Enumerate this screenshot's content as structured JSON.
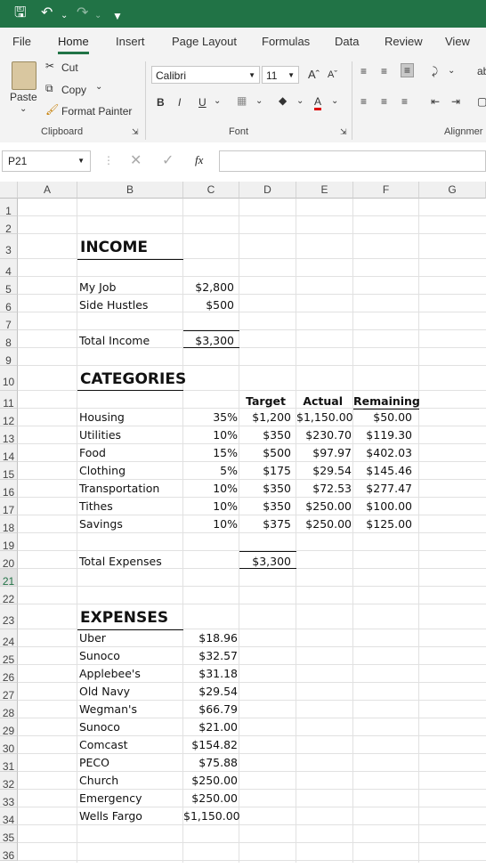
{
  "qat": {
    "save_icon": "save-icon",
    "undo_icon": "undo-icon",
    "redo_icon": "redo-icon",
    "customize_icon": "customize-icon"
  },
  "tabs": [
    "File",
    "Home",
    "Insert",
    "Page Layout",
    "Formulas",
    "Data",
    "Review",
    "View"
  ],
  "ribbon": {
    "clipboard": {
      "paste": "Paste",
      "cut": "Cut",
      "copy": "Copy",
      "format_painter": "Format Painter",
      "label": "Clipboard"
    },
    "font": {
      "name": "Calibri",
      "size": "11",
      "bold": "B",
      "italic": "I",
      "underline": "U",
      "label": "Font"
    },
    "alignment": {
      "label": "Alignmer"
    }
  },
  "formula_bar": {
    "namebox": "P21",
    "fx": "fx",
    "value": ""
  },
  "columns": [
    "A",
    "B",
    "C",
    "D",
    "E",
    "F",
    "G"
  ],
  "rows": [
    "1",
    "2",
    "3",
    "4",
    "5",
    "6",
    "7",
    "8",
    "9",
    "10",
    "11",
    "12",
    "13",
    "14",
    "15",
    "16",
    "17",
    "18",
    "19",
    "20",
    "21",
    "22",
    "23",
    "24",
    "25",
    "26",
    "27",
    "28",
    "29",
    "30",
    "31",
    "32",
    "33",
    "34",
    "35",
    "36"
  ],
  "sheet": {
    "income_header": "INCOME",
    "income": [
      [
        "My Job",
        "$2,800"
      ],
      [
        "Side Hustles",
        "$500"
      ]
    ],
    "total_income": [
      "Total Income",
      "$3,300"
    ],
    "categories_header": "CATEGORIES",
    "cat_cols": [
      "Target",
      "Actual",
      "Remaining"
    ],
    "categories": [
      [
        "Housing",
        "35%",
        "$1,200",
        "$1,150.00",
        "$50.00"
      ],
      [
        "Utilities",
        "10%",
        "$350",
        "$230.70",
        "$119.30"
      ],
      [
        "Food",
        "15%",
        "$500",
        "$97.97",
        "$402.03"
      ],
      [
        "Clothing",
        "5%",
        "$175",
        "$29.54",
        "$145.46"
      ],
      [
        "Transportation",
        "10%",
        "$350",
        "$72.53",
        "$277.47"
      ],
      [
        "Tithes",
        "10%",
        "$350",
        "$250.00",
        "$100.00"
      ],
      [
        "Savings",
        "10%",
        "$375",
        "$250.00",
        "$125.00"
      ]
    ],
    "total_expenses": [
      "Total Expenses",
      "$3,300"
    ],
    "expenses_header": "EXPENSES",
    "expenses": [
      [
        "Uber",
        "$18.96"
      ],
      [
        "Sunoco",
        "$32.57"
      ],
      [
        "Applebee's",
        "$31.18"
      ],
      [
        "Old Navy",
        "$29.54"
      ],
      [
        "Wegman's",
        "$66.79"
      ],
      [
        "Sunoco",
        "$21.00"
      ],
      [
        "Comcast",
        "$154.82"
      ],
      [
        "PECO",
        "$75.88"
      ],
      [
        "Church",
        "$250.00"
      ],
      [
        "Emergency",
        "$250.00"
      ],
      [
        "Wells Fargo",
        "$1,150.00"
      ]
    ]
  }
}
